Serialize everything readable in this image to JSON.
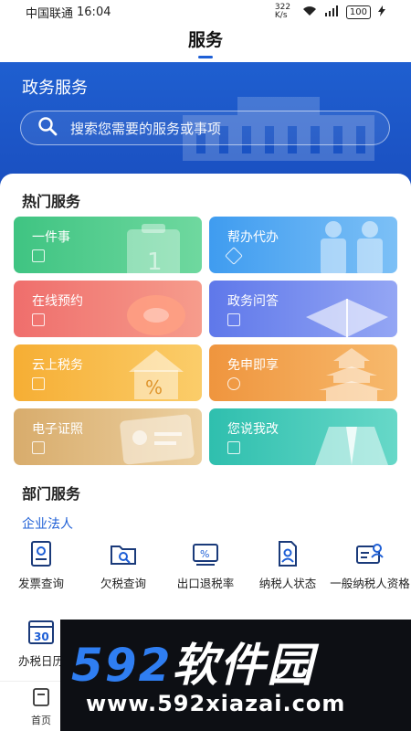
{
  "status_bar": {
    "carrier": "中国联通",
    "time": "16:04",
    "net_speed": "322 K/s",
    "battery": "100"
  },
  "header": {
    "title": "服务"
  },
  "hero": {
    "title": "政务服务",
    "search_placeholder": "搜索您需要的服务或事项"
  },
  "hot_services": {
    "title": "热门服务",
    "items": [
      {
        "label": "一件事",
        "color": "#4cc98a"
      },
      {
        "label": "帮办代办",
        "color": "#4ea6f0"
      },
      {
        "label": "在线预约",
        "color": "#f07a72"
      },
      {
        "label": "政务问答",
        "color": "#6c84ef"
      },
      {
        "label": "云上税务",
        "color": "#f5b640"
      },
      {
        "label": "免申即享",
        "color": "#f2a14a"
      },
      {
        "label": "电子证照",
        "color": "#e0b77a"
      },
      {
        "label": "您说我改",
        "color": "#37c3b3"
      }
    ]
  },
  "dept_services": {
    "title": "部门服务",
    "subtitle": "企业法人",
    "items": [
      {
        "label": "发票查询",
        "icon": "invoice-icon"
      },
      {
        "label": "欠税查询",
        "icon": "folder-search-icon"
      },
      {
        "label": "出口退税率",
        "icon": "percent-card-icon"
      },
      {
        "label": "纳税人状态",
        "icon": "person-doc-icon"
      },
      {
        "label": "一般纳税人资格",
        "icon": "id-card-icon"
      },
      {
        "label": "办税日历",
        "icon": "calendar-icon"
      }
    ]
  },
  "tabbar": {
    "home": "首页"
  },
  "watermark": {
    "num": "592",
    "cn": "软件园",
    "url": "www.592xiazai.com"
  },
  "colors": {
    "primary": "#1e5fd6",
    "hero_bg": "#1f5fd0"
  }
}
